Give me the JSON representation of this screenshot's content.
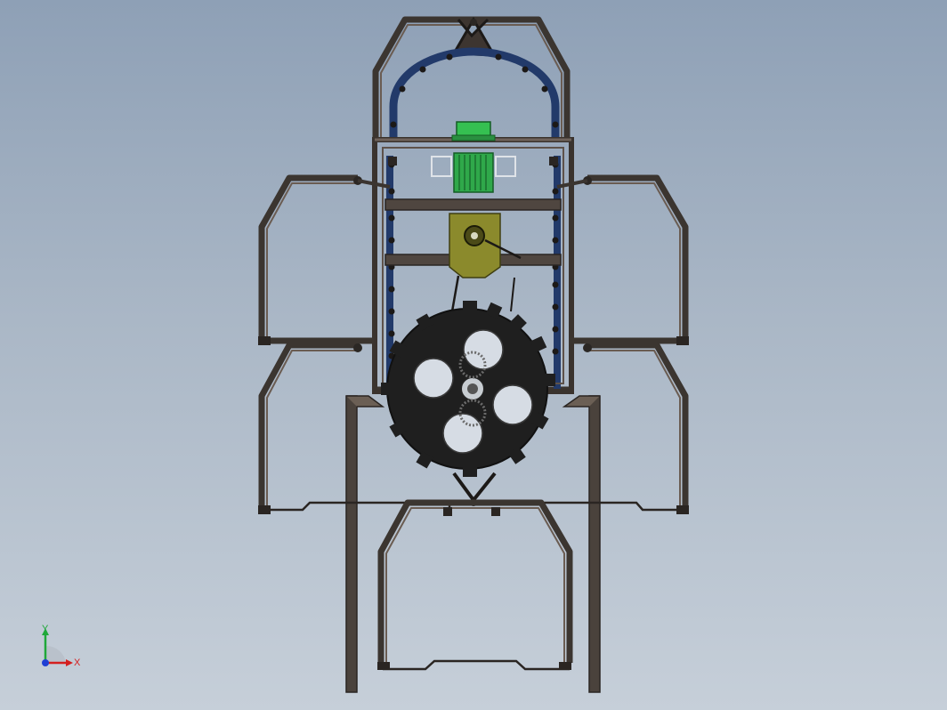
{
  "viewport": {
    "background": "#a9b6c6"
  },
  "colors": {
    "frame": "#3b3530",
    "chain": "#223a6a",
    "motor": "#2fa84a",
    "gearbox": "#8b8a2c",
    "sprocket": "#1f1f1f",
    "axis_x": "#d41f1f",
    "axis_y": "#1fa83a",
    "axis_z": "#1f3fd4"
  },
  "triad": {
    "x_label": "X",
    "y_label": "Y"
  }
}
